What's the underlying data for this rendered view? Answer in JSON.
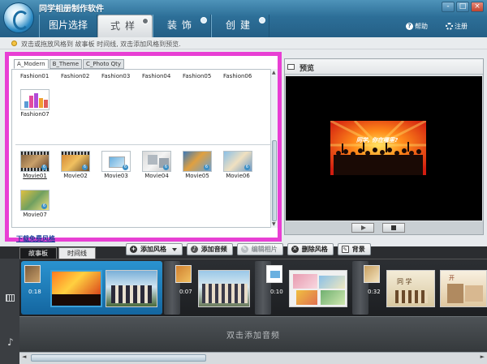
{
  "window": {
    "title": "同学相册制作软件",
    "controls": [
      "-",
      "□",
      "×"
    ]
  },
  "tabs": [
    {
      "label": "图片选择"
    },
    {
      "label": "式样"
    },
    {
      "label": "装饰"
    },
    {
      "label": "创建"
    }
  ],
  "header_right": {
    "help": "帮助",
    "register": "注册"
  },
  "info": {
    "text": "双击或拖放风格到 故事板 时间线, 双击添加风格到预览."
  },
  "style_panel": {
    "tabs": [
      "A_Modern",
      "B_Theme",
      "C_Photo Qty"
    ],
    "top_labels": [
      "Fashion01",
      "Fashion02",
      "Fashion03",
      "Fashion04",
      "Fashion05",
      "Fashion06"
    ],
    "fashion07": "Fashion07",
    "movies": [
      "Movie01",
      "Movie02",
      "Movie03",
      "Movie04",
      "Movie05",
      "Movie06",
      "Movie07"
    ],
    "download_link": "下载免费风格"
  },
  "preview": {
    "title": "预览",
    "overlay_text": "同学, 你在哪里?"
  },
  "toolbar": {
    "add_style": "添加风格",
    "add_music": "添加音频",
    "edit_photo": "编辑相片",
    "delete_style": "删除风格",
    "background": "背景"
  },
  "timeline": {
    "tab_storyboard": "故事板",
    "tab_timeline": "时间线",
    "clips": [
      {
        "time": "0:18"
      },
      {
        "time": "0:07"
      },
      {
        "time": "0:10"
      },
      {
        "time": "0:32"
      }
    ],
    "music_placeholder": "双击添加音频",
    "thumb_text_a": "同 学",
    "thumb_text_b": "开"
  },
  "colors": {
    "titlebar": "#2d6f98",
    "highlight_border": "#e83fd4",
    "selected_clip": "#1d79b4",
    "timeline_bg": "#2b2d30"
  }
}
